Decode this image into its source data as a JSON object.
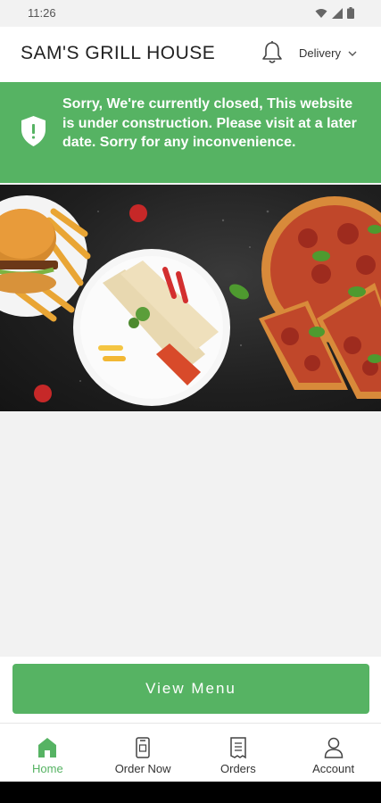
{
  "status_bar": {
    "time": "11:26"
  },
  "header": {
    "title": "SAM'S GRILL HOUSE",
    "mode_label": "Delivery"
  },
  "banner": {
    "message": "Sorry, We're currently closed, This website is under construction. Please visit at a later date. Sorry for any inconvenience."
  },
  "hero": {
    "icon": "food-hero-image"
  },
  "actions": {
    "view_menu_label": "View Menu"
  },
  "bottom_nav": {
    "items": [
      {
        "label": "Home",
        "icon": "home-icon",
        "active": true
      },
      {
        "label": "Order Now",
        "icon": "phone-icon",
        "active": false
      },
      {
        "label": "Orders",
        "icon": "receipt-icon",
        "active": false
      },
      {
        "label": "Account",
        "icon": "user-icon",
        "active": false
      }
    ]
  },
  "colors": {
    "accent": "#56b363",
    "background": "#f2f2f2"
  }
}
